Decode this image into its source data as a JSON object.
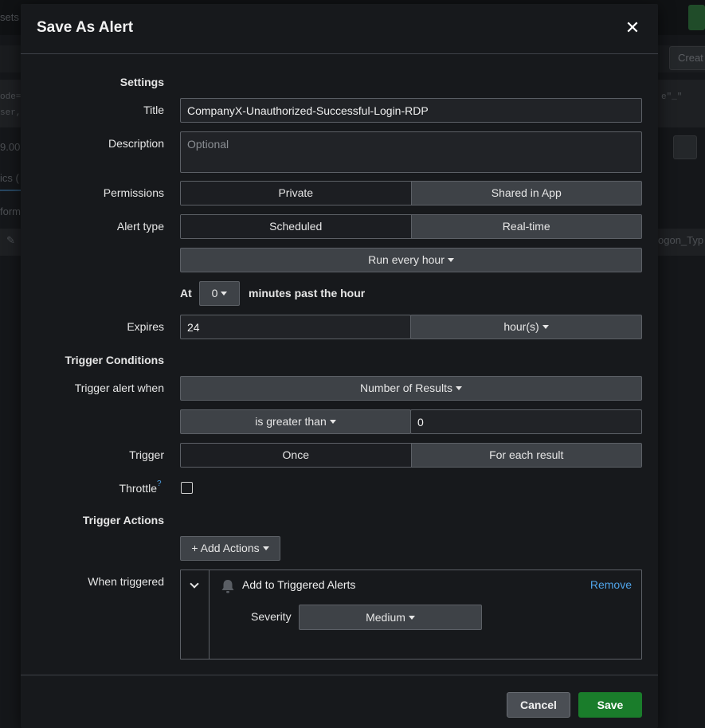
{
  "background": {
    "top_left_text": "sets",
    "create_button": "Creat",
    "code_left_1": "ode=",
    "code_left_2": "ser,",
    "code_right": "e\"_\"",
    "num_text": "9.00",
    "tab_text": "ics (",
    "format_text": "form",
    "field_text": "ogon_Typ"
  },
  "modal": {
    "title": "Save As Alert",
    "close_icon": "close-icon"
  },
  "form": {
    "settings_heading": "Settings",
    "title_label": "Title",
    "title_value": "CompanyX-Unauthorized-Successful-Login-RDP",
    "description_label": "Description",
    "description_placeholder": "Optional",
    "permissions_label": "Permissions",
    "permissions_options": [
      "Private",
      "Shared in App"
    ],
    "alert_type_label": "Alert type",
    "alert_type_options": [
      "Scheduled",
      "Real-time"
    ],
    "schedule_value": "Run every hour",
    "at_label": "At",
    "minutes_value": "0",
    "minutes_suffix": "minutes past the hour",
    "expires_label": "Expires",
    "expires_value": "24",
    "expires_unit": "hour(s)",
    "trigger_conditions_heading": "Trigger Conditions",
    "trigger_when_label": "Trigger alert when",
    "trigger_when_value": "Number of Results",
    "comparison_value": "is greater than",
    "comparison_number": "0",
    "trigger_label": "Trigger",
    "trigger_options": [
      "Once",
      "For each result"
    ],
    "throttle_label": "Throttle",
    "throttle_help": "?",
    "trigger_actions_heading": "Trigger Actions",
    "add_actions_label": "+ Add Actions",
    "when_triggered_label": "When triggered",
    "action": {
      "name": "Add to Triggered Alerts",
      "remove_label": "Remove",
      "severity_label": "Severity",
      "severity_value": "Medium"
    }
  },
  "footer": {
    "cancel_label": "Cancel",
    "save_label": "Save"
  },
  "colors": {
    "save_button": "#1a7d2b",
    "link": "#4fa3e8",
    "modal_bg": "#17191c"
  }
}
